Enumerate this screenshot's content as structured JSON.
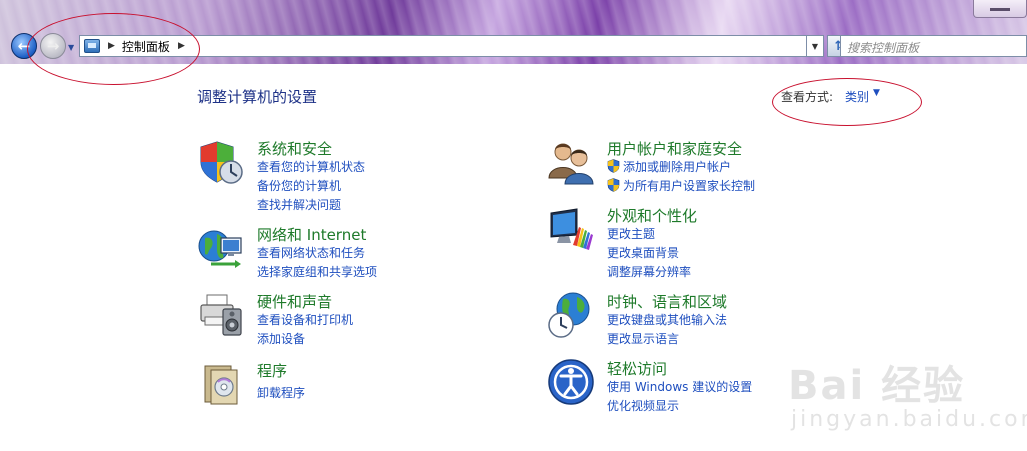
{
  "address_bar": {
    "breadcrumb": "控制面板",
    "search_placeholder": "搜索控制面板"
  },
  "main": {
    "heading": "调整计算机的设置",
    "view_by_label": "查看方式:",
    "view_by_value": "类别"
  },
  "categories": [
    {
      "title": "系统和安全",
      "icon": "shield-icon",
      "links": [
        "查看您的计算机状态",
        "备份您的计算机",
        "查找并解决问题"
      ]
    },
    {
      "title": "网络和 Internet",
      "icon": "network-globe-icon",
      "links": [
        "查看网络状态和任务",
        "选择家庭组和共享选项"
      ]
    },
    {
      "title": "硬件和声音",
      "icon": "printer-icon",
      "links": [
        "查看设备和打印机",
        "添加设备"
      ]
    },
    {
      "title": "程序",
      "icon": "programs-icon",
      "links": [
        "卸载程序"
      ]
    },
    {
      "title": "用户帐户和家庭安全",
      "icon": "users-icon",
      "links": [
        "添加或删除用户帐户",
        "为所有用户设置家长控制"
      ]
    },
    {
      "title": "外观和个性化",
      "icon": "display-paint-icon",
      "links": [
        "更改主题",
        "更改桌面背景",
        "调整屏幕分辨率"
      ]
    },
    {
      "title": "时钟、语言和区域",
      "icon": "clock-globe-icon",
      "links": [
        "更改键盘或其他输入法",
        "更改显示语言"
      ]
    },
    {
      "title": "轻松访问",
      "icon": "ease-of-access-icon",
      "links": [
        "使用 Windows 建议的设置",
        "优化视频显示"
      ]
    }
  ],
  "watermark": {
    "brand": "Bai 经验",
    "url": "jingyan.baidu.com"
  },
  "colors": {
    "link": "#1f4fbf",
    "category_title": "#1e7a2a",
    "heading": "#1e3287",
    "annotation": "#c8102e"
  }
}
